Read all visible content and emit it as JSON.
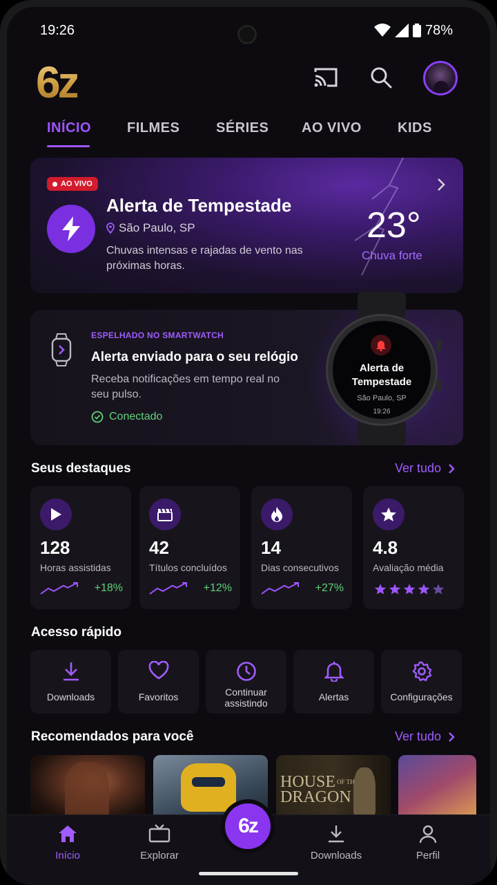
{
  "status_bar": {
    "time": "19:26",
    "battery": "78%"
  },
  "header": {
    "logo": "6z"
  },
  "tabs": [
    {
      "label": "INÍCIO"
    },
    {
      "label": "FILMES"
    },
    {
      "label": "SÉRIES"
    },
    {
      "label": "AO VIVO"
    },
    {
      "label": "KIDS"
    }
  ],
  "alert": {
    "badge": "AO VIVO",
    "title": "Alerta de Tempestade",
    "location": "São Paulo, SP",
    "description": "Chuvas intensas e rajadas de vento nas próximas horas.",
    "temperature": "23°",
    "condition": "Chuva forte"
  },
  "watch": {
    "kicker": "ESPELHADO NO SMARTWATCH",
    "title": "Alerta enviado para o seu relógio",
    "description": "Receba notificações em tempo real no seu pulso.",
    "status": "Conectado",
    "face_title": "Alerta de Tempestade",
    "face_location": "São Paulo, SP",
    "face_time": "19:26"
  },
  "highlights": {
    "title": "Seus destaques",
    "link": "Ver tudo",
    "stats": [
      {
        "icon": "play-icon",
        "value": "128",
        "label": "Horas assistidas",
        "change": "+18%"
      },
      {
        "icon": "clapperboard-icon",
        "value": "42",
        "label": "Títulos concluídos",
        "change": "+12%"
      },
      {
        "icon": "flame-icon",
        "value": "14",
        "label": "Dias consecutivos",
        "change": "+27%"
      },
      {
        "icon": "star-icon",
        "value": "4.8",
        "label": "Avaliação média",
        "rating": 4.8
      }
    ]
  },
  "quick_access": {
    "title": "Acesso rápido",
    "items": [
      {
        "icon": "download-icon",
        "label": "Downloads"
      },
      {
        "icon": "heart-icon",
        "label": "Favoritos"
      },
      {
        "icon": "clock-icon",
        "label_line1": "Continuar",
        "label_line2": "assistindo"
      },
      {
        "icon": "bell-icon",
        "label": "Alertas"
      },
      {
        "icon": "gear-icon",
        "label": "Configurações"
      }
    ]
  },
  "recommended": {
    "title": "Recomendados para você",
    "link": "Ver tudo",
    "poster3_line1": "HOUSE",
    "poster3_of": "OF THE",
    "poster3_line2": "DRAGON"
  },
  "bottom_nav": [
    {
      "icon": "home-icon",
      "label": "Início"
    },
    {
      "icon": "tv-icon",
      "label": "Explorar"
    },
    {
      "icon": "logo-fab",
      "label": "6z"
    },
    {
      "icon": "download-icon",
      "label": "Downloads"
    },
    {
      "icon": "user-icon",
      "label": "Perfil"
    }
  ],
  "colors": {
    "accent": "#9f55ff",
    "live": "#d21b2c",
    "positive": "#5fd27a",
    "background": "#0d0b10"
  }
}
